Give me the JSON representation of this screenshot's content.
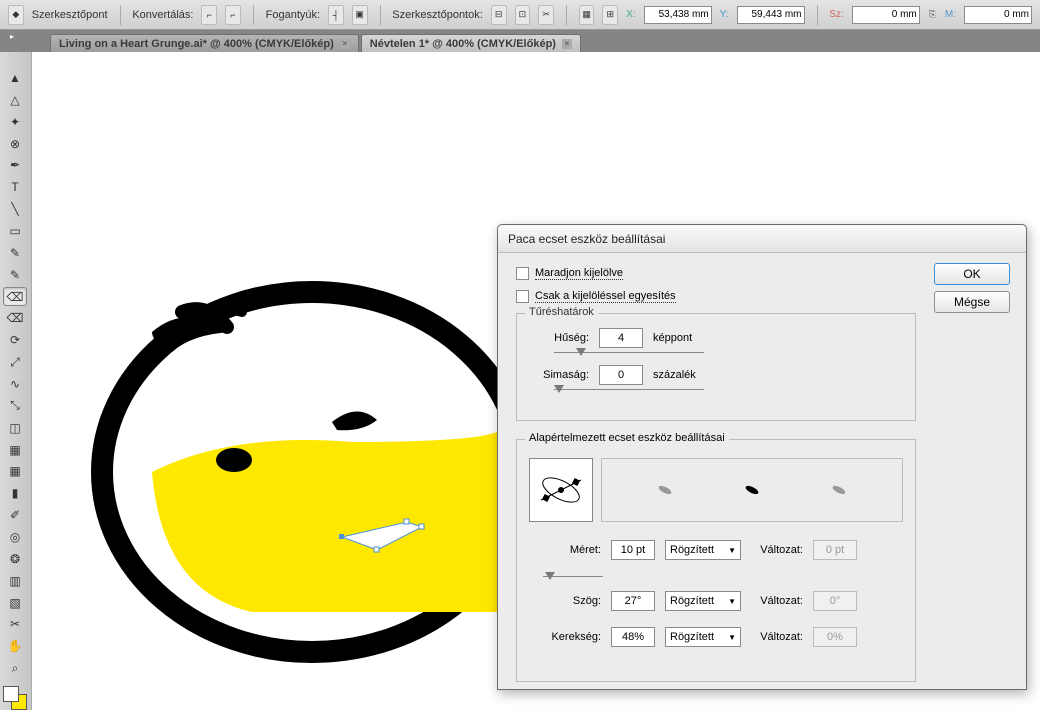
{
  "options": {
    "anchor_label": "Szerkesztőpont",
    "convert_label": "Konvertálás:",
    "handles_label": "Fogantyúk:",
    "anchors_label": "Szerkesztőpontok:",
    "x_label": "X:",
    "x_value": "53,438 mm",
    "y_label": "Y:",
    "y_value": "59,443 mm",
    "w_label": "Sz:",
    "w_value": "0 mm",
    "h_label": "M:",
    "h_value": "0 mm"
  },
  "tabs": [
    {
      "label": "Living on a Heart Grunge.ai* @ 400% (CMYK/Előkép)"
    },
    {
      "label": "Névtelen 1* @ 400% (CMYK/Előkép)"
    }
  ],
  "tools": [
    {
      "name": "selection-tool",
      "glyph": "▲"
    },
    {
      "name": "direct-select-tool",
      "glyph": "△"
    },
    {
      "name": "magic-wand-tool",
      "glyph": "✦"
    },
    {
      "name": "lasso-tool",
      "glyph": "⊗"
    },
    {
      "name": "pen-tool",
      "glyph": "✒"
    },
    {
      "name": "type-tool",
      "glyph": "T"
    },
    {
      "name": "line-tool",
      "glyph": "╲"
    },
    {
      "name": "rectangle-tool",
      "glyph": "▭"
    },
    {
      "name": "paintbrush-tool",
      "glyph": "✎"
    },
    {
      "name": "pencil-tool",
      "glyph": "✎"
    },
    {
      "name": "blob-brush-tool",
      "glyph": "⌫",
      "selected": true
    },
    {
      "name": "eraser-tool",
      "glyph": "⌫"
    },
    {
      "name": "rotate-tool",
      "glyph": "⟳"
    },
    {
      "name": "scale-tool",
      "glyph": "⤢"
    },
    {
      "name": "width-tool",
      "glyph": "∿"
    },
    {
      "name": "free-transform-tool",
      "glyph": "⤡"
    },
    {
      "name": "shape-builder-tool",
      "glyph": "◫"
    },
    {
      "name": "perspective-tool",
      "glyph": "▦"
    },
    {
      "name": "mesh-tool",
      "glyph": "▦"
    },
    {
      "name": "gradient-tool",
      "glyph": "▮"
    },
    {
      "name": "eyedropper-tool",
      "glyph": "✐"
    },
    {
      "name": "blend-tool",
      "glyph": "◎"
    },
    {
      "name": "symbol-tool",
      "glyph": "❂"
    },
    {
      "name": "graph-tool",
      "glyph": "▥"
    },
    {
      "name": "artboard-tool",
      "glyph": "▧"
    },
    {
      "name": "slice-tool",
      "glyph": "✂"
    },
    {
      "name": "hand-tool",
      "glyph": "✋"
    },
    {
      "name": "zoom-tool",
      "glyph": "⌕"
    }
  ],
  "dialog": {
    "title": "Paca ecset eszköz beállításai",
    "ok": "OK",
    "cancel": "Mégse",
    "keep_selected": "Maradjon kijelölve",
    "merge_only": "Csak a kijelöléssel egyesítés",
    "tolerances_legend": "Tűréshatárok",
    "fidelity_label": "Hűség:",
    "fidelity_value": "4",
    "fidelity_unit": "képpont",
    "smoothness_label": "Simaság:",
    "smoothness_value": "0",
    "smoothness_unit": "százalék",
    "default_legend": "Alapértelmezett ecset eszköz beállításai",
    "size_label": "Méret:",
    "size_value": "10 pt",
    "angle_label": "Szög:",
    "angle_value": "27°",
    "roundness_label": "Kerekség:",
    "roundness_value": "48%",
    "mode": "Rögzített",
    "variation_label": "Változat:",
    "var_size": "0 pt",
    "var_angle": "0°",
    "var_round": "0%"
  }
}
